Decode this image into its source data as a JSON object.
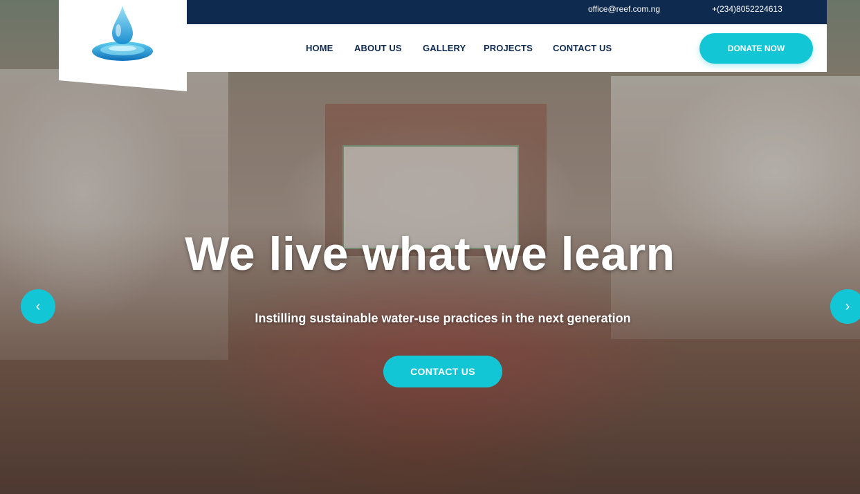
{
  "topbar": {
    "email": "office@reef.com.ng",
    "phone": "+(234)8052224613"
  },
  "nav": {
    "items": [
      "HOME",
      "ABOUT US",
      "GALLERY",
      "PROJECTS",
      "CONTACT US"
    ],
    "donate_label": "DONATE NOW"
  },
  "hero": {
    "headline": "We live what we learn",
    "subline": "Instilling sustainable water-use practices in the next generation",
    "cta_label": "CONTACT US",
    "prev_icon": "chevron-left-icon",
    "next_icon": "chevron-right-icon"
  },
  "colors": {
    "navy": "#0f2a4f",
    "accent": "#13c6d6",
    "white": "#ffffff"
  }
}
